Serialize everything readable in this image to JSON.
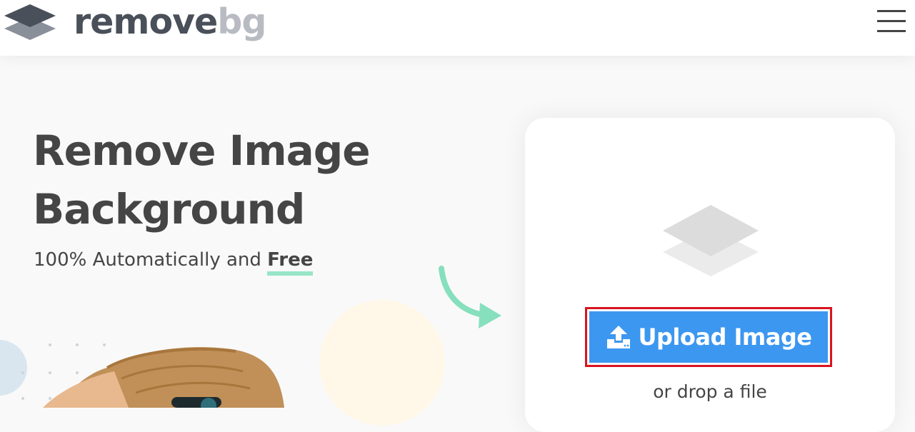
{
  "header": {
    "logo_word_1": "remove",
    "logo_word_2": "bg",
    "menu_icon": "hamburger-icon"
  },
  "hero": {
    "title_line_1": "Remove Image",
    "title_line_2": "Background",
    "subtitle_prefix": "100% Automatically and ",
    "subtitle_emphasis": "Free"
  },
  "upload": {
    "button_label": "Upload Image",
    "button_icon": "upload-icon",
    "drop_text": "or drop a file"
  },
  "colors": {
    "accent_blue": "#3c97f0",
    "highlight_border": "#d8141e",
    "underline_green": "#96e5c6",
    "text_dark": "#454545",
    "logo_gray": "#b8bcc2"
  }
}
